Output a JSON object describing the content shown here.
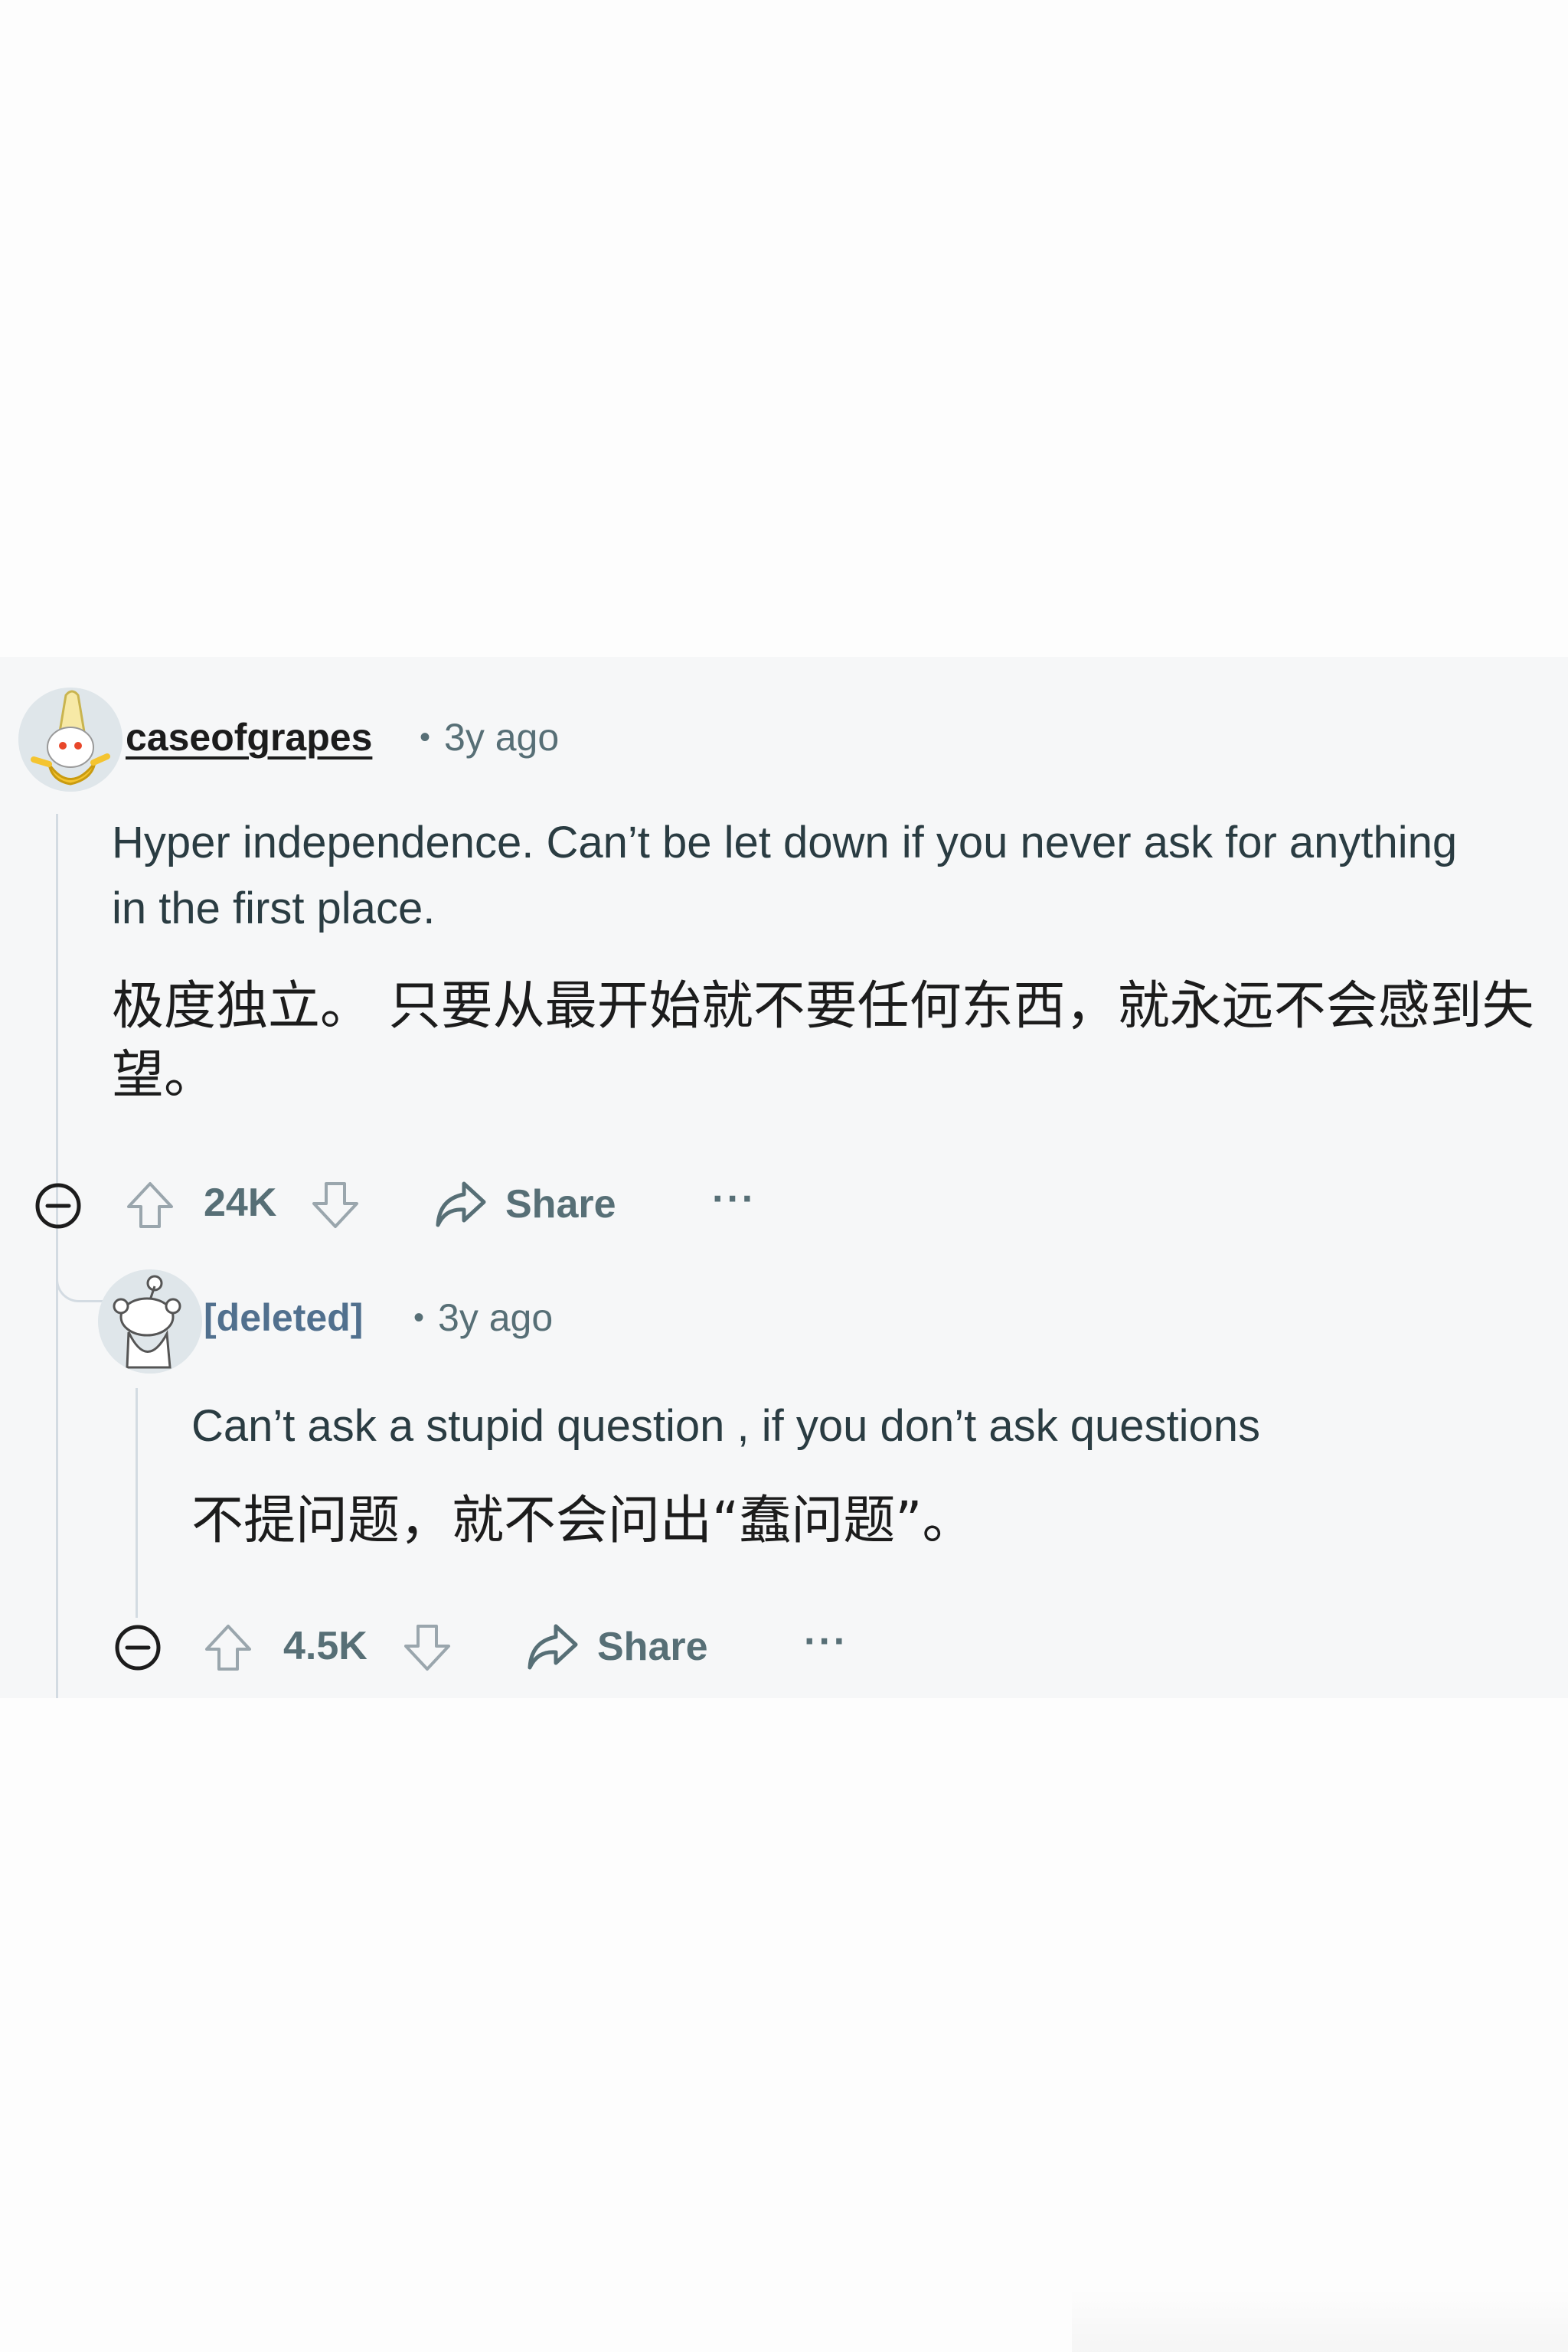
{
  "comments": [
    {
      "username": "caseofgrapes",
      "separator": "•",
      "time": "3y ago",
      "body_en": "Hyper independence. Can’t be let down if you never ask for anything in the first place.",
      "body_cn": "极度独立。 只要从最开始就不要任何东西，就永远不会感到失望。",
      "votes": "24K",
      "share_label": "Share",
      "more_label": "···"
    },
    {
      "username": "[deleted]",
      "separator": "•",
      "time": "3y ago",
      "body_en": "Can’t ask a stupid question , if you don’t ask questions",
      "body_cn": "不提问题，就不会问出“蠢问题”。",
      "votes": "4.5K",
      "share_label": "Share",
      "more_label": "···"
    }
  ],
  "icons": {
    "collapse": "minus-circle-icon",
    "upvote": "arrow-up-outline-icon",
    "downvote": "arrow-down-outline-icon",
    "share": "share-arrow-icon",
    "more": "ellipsis-icon"
  },
  "colors": {
    "panel_background": "#f6f7f8",
    "meta_text": "#576f76",
    "deleted_username": "#51708e",
    "thread_line": "#d3dbe2"
  }
}
